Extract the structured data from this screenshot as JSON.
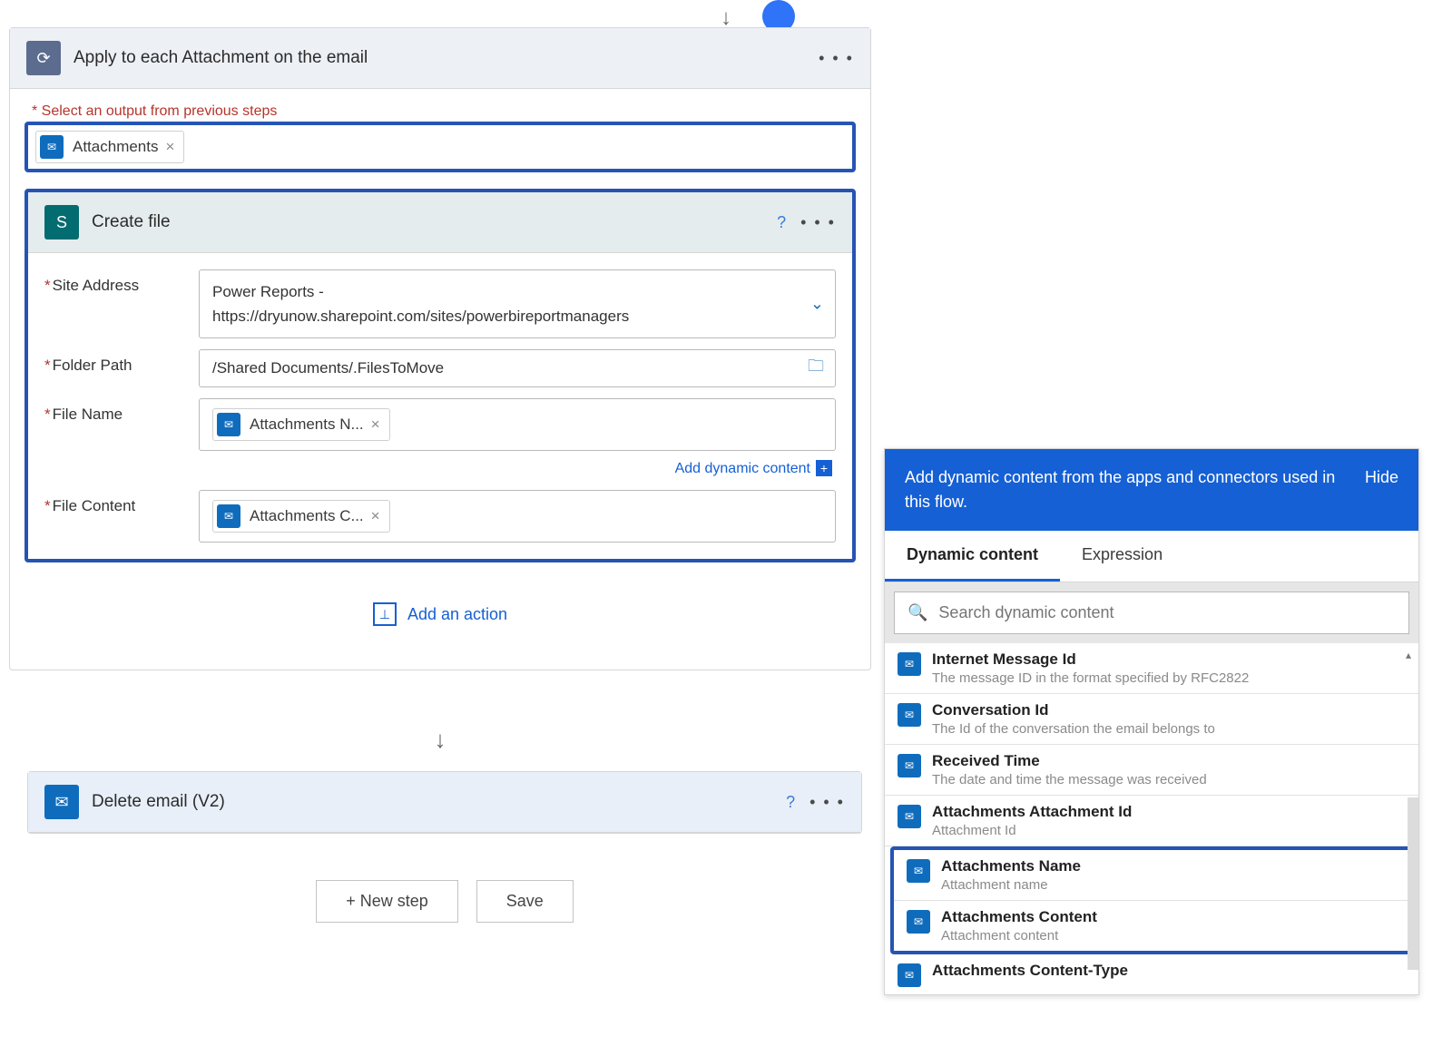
{
  "foreach": {
    "title": "Apply to each Attachment on the email",
    "outputHint": "* Select an output from previous steps",
    "token": "Attachments"
  },
  "createFile": {
    "title": "Create file",
    "fields": {
      "siteAddress": {
        "label": "Site Address",
        "line1": "Power Reports -",
        "line2": "https://dryunow.sharepoint.com/sites/powerbireportmanagers"
      },
      "folderPath": {
        "label": "Folder Path",
        "value": "/Shared Documents/.FilesToMove"
      },
      "fileName": {
        "label": "File Name",
        "token": "Attachments N..."
      },
      "fileContent": {
        "label": "File Content",
        "token": "Attachments C..."
      }
    },
    "dynamicLink": "Add dynamic content"
  },
  "addAction": "Add an action",
  "deleteEmail": {
    "title": "Delete email (V2)"
  },
  "buttons": {
    "newStep": "+ New step",
    "save": "Save"
  },
  "panel": {
    "headText": "Add dynamic content from the apps and connectors used in this flow.",
    "hide": "Hide",
    "tabs": {
      "dynamic": "Dynamic content",
      "expression": "Expression"
    },
    "searchPlaceholder": "Search dynamic content",
    "items": [
      {
        "title": "Internet Message Id",
        "desc": "The message ID in the format specified by RFC2822"
      },
      {
        "title": "Conversation Id",
        "desc": "The Id of the conversation the email belongs to"
      },
      {
        "title": "Received Time",
        "desc": "The date and time the message was received"
      },
      {
        "title": "Attachments Attachment Id",
        "desc": "Attachment Id"
      },
      {
        "title": "Attachments Name",
        "desc": "Attachment name"
      },
      {
        "title": "Attachments Content",
        "desc": "Attachment content"
      },
      {
        "title": "Attachments Content-Type",
        "desc": ""
      }
    ]
  }
}
